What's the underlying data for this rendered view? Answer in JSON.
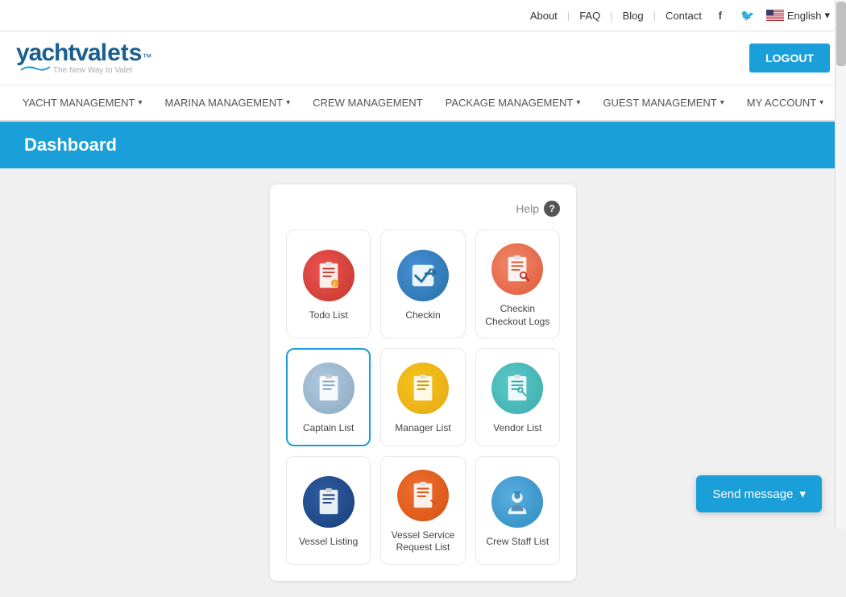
{
  "topbar": {
    "about": "About",
    "faq": "FAQ",
    "blog": "Blog",
    "contact": "Contact",
    "language": "English",
    "sep1": "|",
    "sep2": "|",
    "sep3": "|"
  },
  "header": {
    "logo_text": "yachtvalets",
    "logo_tm": "™",
    "tagline": "The New Way to Valet",
    "logout_label": "LOGOUT"
  },
  "nav": {
    "items": [
      {
        "label": "YACHT MANAGEMENT",
        "has_arrow": true
      },
      {
        "label": "MARINA MANAGEMENT",
        "has_arrow": true
      },
      {
        "label": "CREW MANAGEMENT",
        "has_arrow": false
      },
      {
        "label": "PACKAGE MANAGEMENT",
        "has_arrow": true
      },
      {
        "label": "GUEST MANAGEMENT",
        "has_arrow": true
      },
      {
        "label": "MY ACCOUNT",
        "has_arrow": true
      }
    ]
  },
  "dashboard": {
    "title": "Dashboard",
    "help_label": "Help"
  },
  "icons": [
    {
      "id": "todo-list",
      "label": "Todo List",
      "color_class": "ic-red",
      "icon": "📋",
      "active": false
    },
    {
      "id": "checkin",
      "label": "Checkin",
      "color_class": "ic-blue",
      "icon": "📤",
      "active": false
    },
    {
      "id": "checkin-checkout-logs",
      "label": "Checkin Checkout Logs",
      "color_class": "ic-salmon",
      "icon": "📋",
      "active": false
    },
    {
      "id": "captain-list",
      "label": "Captain List",
      "color_class": "ic-light-blue-gray",
      "icon": "📋",
      "active": true
    },
    {
      "id": "manager-list",
      "label": "Manager List",
      "color_class": "ic-yellow",
      "icon": "📋",
      "active": false
    },
    {
      "id": "vendor-list",
      "label": "Vendor List",
      "color_class": "ic-teal",
      "icon": "📋",
      "active": false
    },
    {
      "id": "vessel-listing",
      "label": "Vessel Listing",
      "color_class": "ic-navy",
      "icon": "📋",
      "active": false
    },
    {
      "id": "vessel-service-request-list",
      "label": "Vessel Service Request List",
      "color_class": "ic-orange-red",
      "icon": "📝",
      "active": false
    },
    {
      "id": "crew-staff-list",
      "label": "Crew Staff List",
      "color_class": "ic-avatar-blue",
      "icon": "👩",
      "active": false
    }
  ],
  "send_message": {
    "label": "Send message"
  }
}
